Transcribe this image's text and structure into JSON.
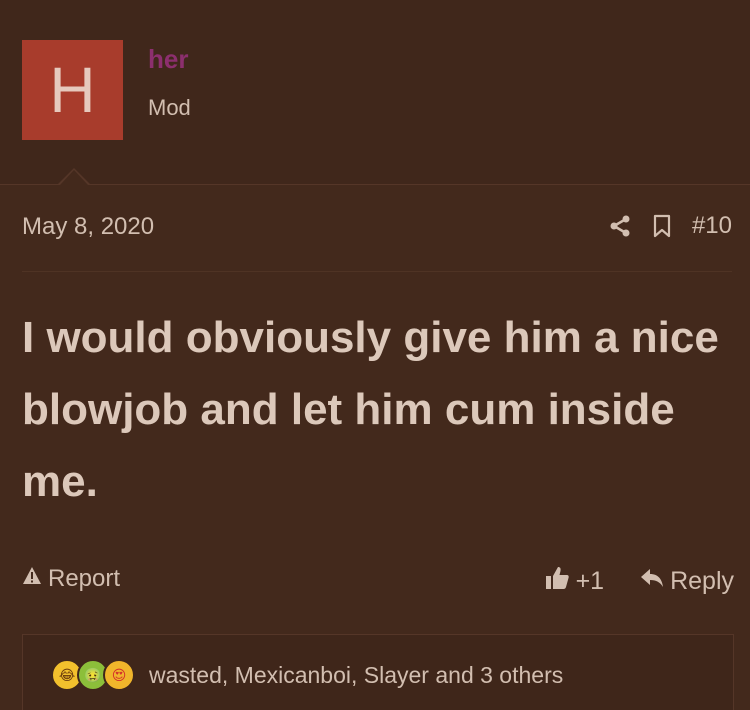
{
  "user": {
    "avatar_letter": "H",
    "username": "her",
    "role": "Mod"
  },
  "post": {
    "date": "May 8, 2020",
    "number": "#10",
    "message": "I would obviously give him a nice blowjob and let him cum inside me.",
    "icons": [
      "share-icon",
      "bookmark-icon"
    ]
  },
  "footer": {
    "report_label": "Report",
    "like_count": "+1",
    "reply_label": "Reply"
  },
  "reactions": {
    "emojis": [
      "laughing-crying-emoji",
      "sick-emoji",
      "heart-eyes-emoji"
    ],
    "summary": "wasted, Mexicanboi, Slayer and 3 others"
  },
  "colors": {
    "background": "#43291c",
    "avatar": "#a83c2c",
    "username": "#8c2f6e",
    "text": "#d2beb0"
  }
}
